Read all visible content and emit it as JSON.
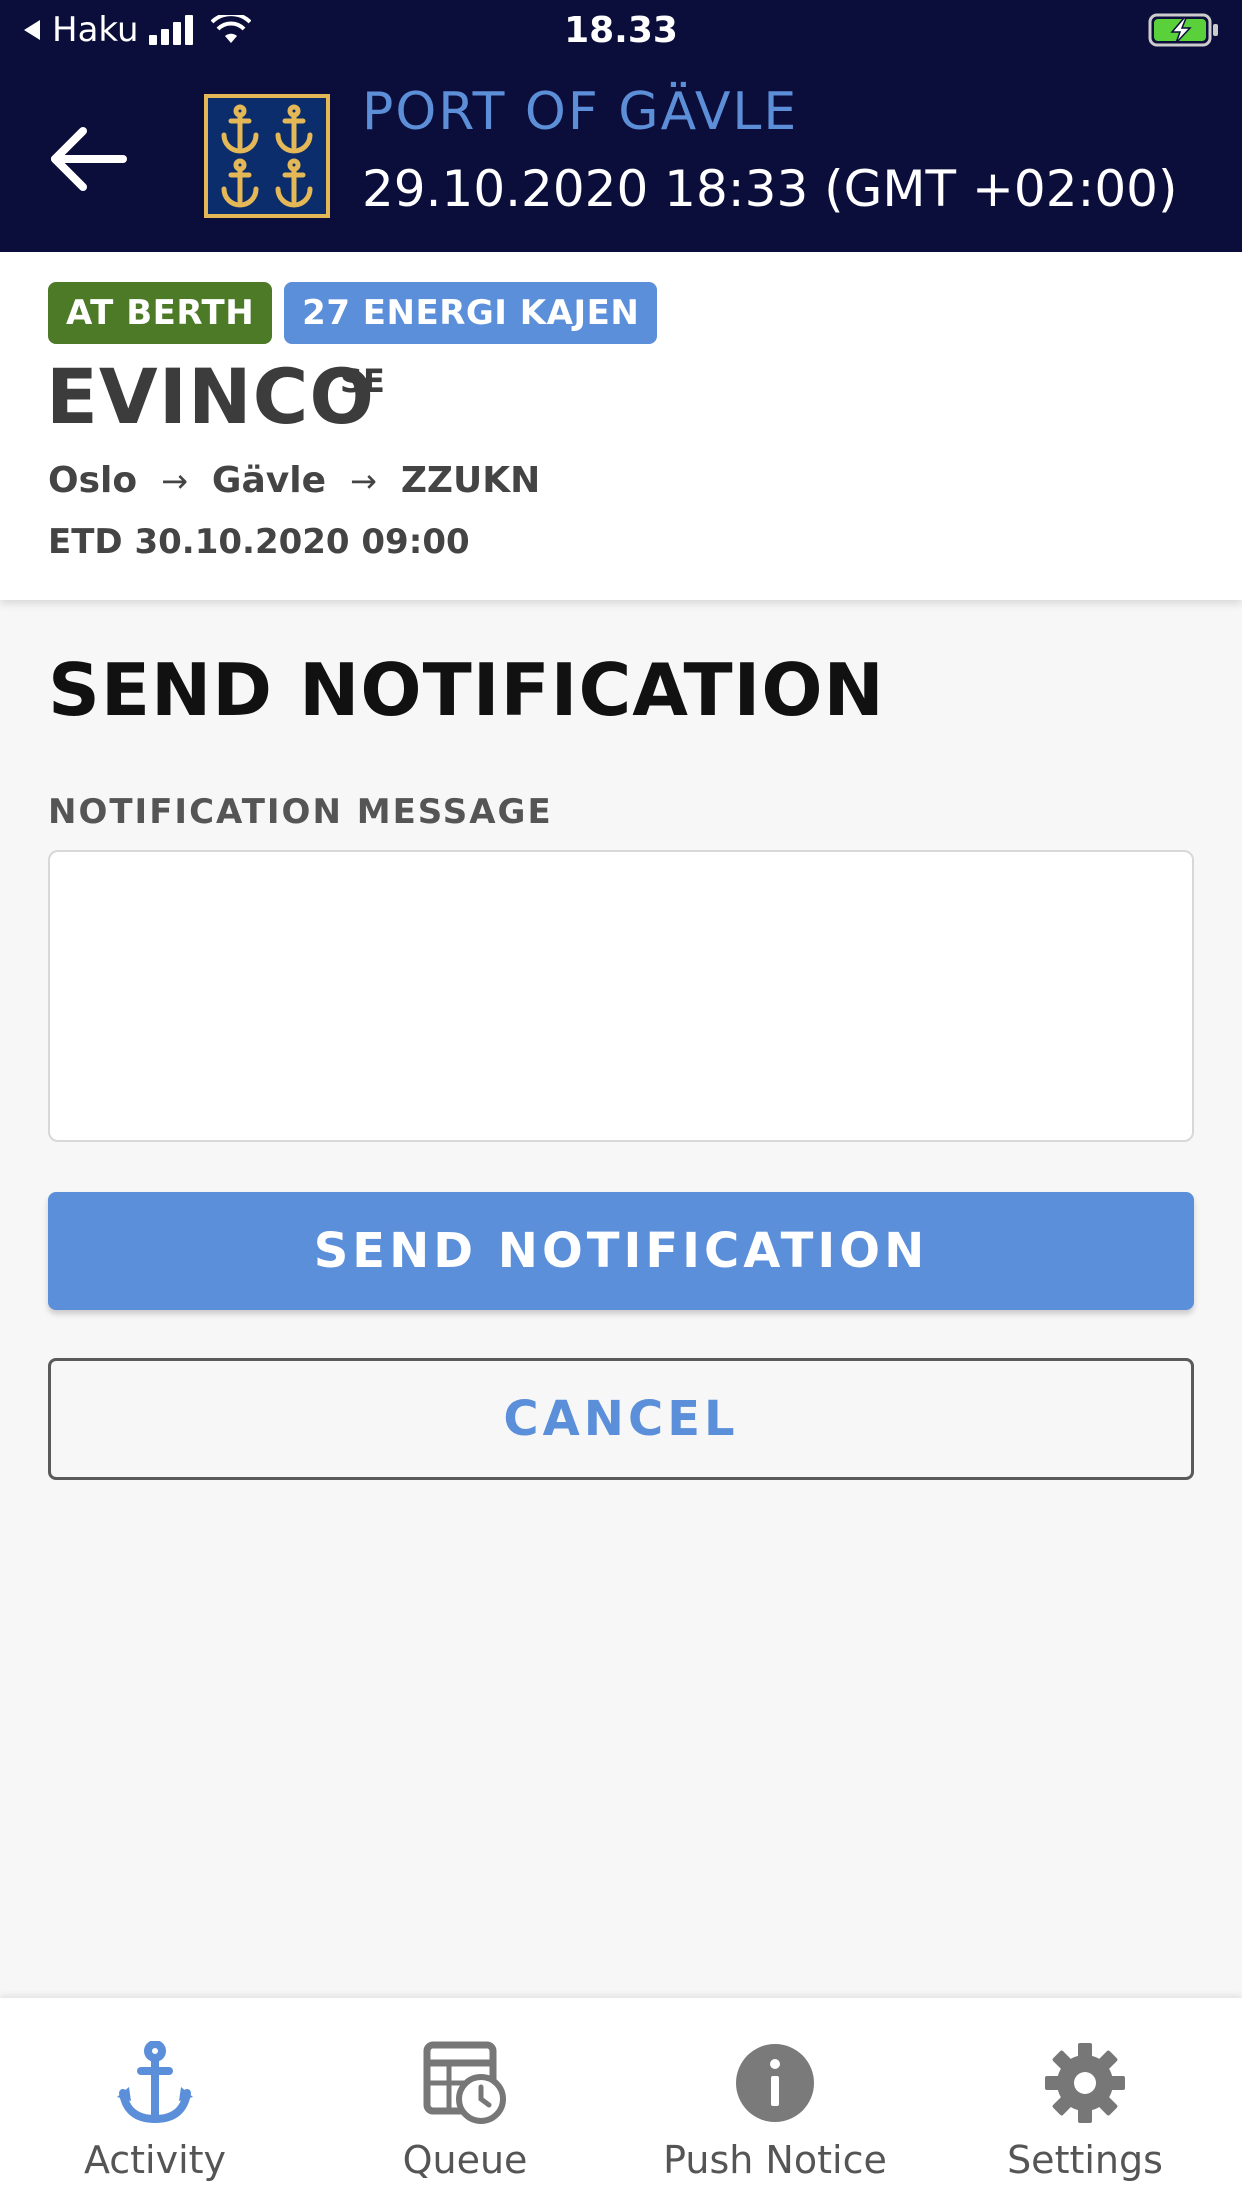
{
  "status_bar": {
    "back_app": "Haku",
    "time": "18.33"
  },
  "header": {
    "port_name": "PORT OF GÄVLE",
    "datetime": "29.10.2020 18:33 (GMT +02:00)"
  },
  "vessel": {
    "status_badge": "AT BERTH",
    "berth_badge": "27 ENERGI KAJEN",
    "name": "EVINCO",
    "flag": "SE",
    "route": [
      "Oslo",
      "Gävle",
      "ZZUKN"
    ],
    "etd": "ETD 30.10.2020 09:00"
  },
  "form": {
    "title": "SEND NOTIFICATION",
    "message_label": "NOTIFICATION MESSAGE",
    "message_value": "",
    "send_label": "SEND NOTIFICATION",
    "cancel_label": "CANCEL"
  },
  "tabs": [
    {
      "label": "Activity",
      "icon": "anchor-icon",
      "active": true
    },
    {
      "label": "Queue",
      "icon": "queue-calendar-icon",
      "active": false
    },
    {
      "label": "Push Notice",
      "icon": "info-icon",
      "active": false
    },
    {
      "label": "Settings",
      "icon": "gear-icon",
      "active": false
    }
  ],
  "colors": {
    "header_bg": "#0b0e3b",
    "accent_blue": "#5b8fd9",
    "status_green": "#4c7a26",
    "logo_gold": "#e4b856"
  }
}
